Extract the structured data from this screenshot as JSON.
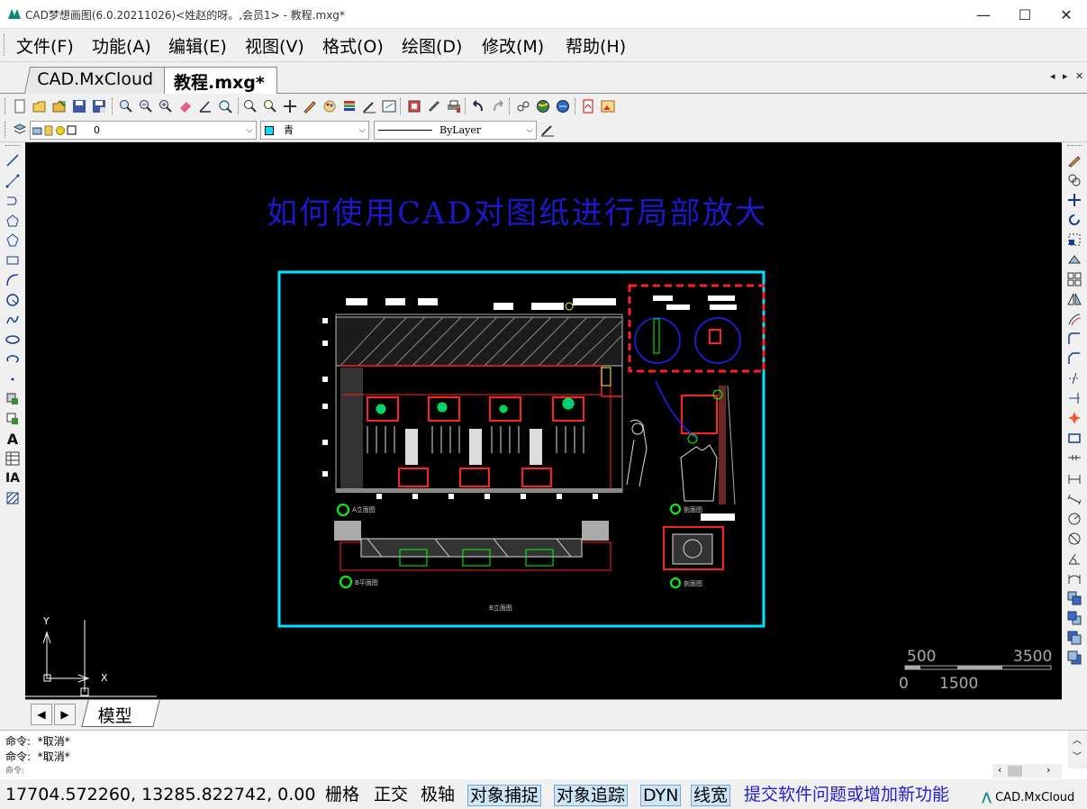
{
  "window": {
    "title": "CAD梦想画图(6.0.20211026)<姓赵的呀。,会员1> - 教程.mxg*",
    "minimize": "—",
    "maximize": "☐",
    "close": "✕"
  },
  "menu": [
    "文件(F)",
    "功能(A)",
    "编辑(E)",
    "视图(V)",
    "格式(O)",
    "绘图(D)",
    "修改(M)",
    "帮助(H)"
  ],
  "tabs": {
    "inactive": "CAD.MxCloud",
    "active": "教程.mxg*",
    "nav_left": "◂",
    "nav_right": "▸",
    "close": "✕"
  },
  "layer_bar": {
    "layer_value": "0",
    "color_value": "青",
    "linetype_value": "ByLayer"
  },
  "drawing": {
    "heading": "如何使用CAD对图纸进行局部放大",
    "label_elevation_a": "A立面图",
    "label_plan_b": "B平面图",
    "label_detail_c": "剖面图",
    "label_detail_d": "剖面图",
    "label_center": "B立面图",
    "scale_500": "500",
    "scale_3500": "3500",
    "scale_0": "0",
    "scale_1500": "1500",
    "ucs_x": "X",
    "ucs_y": "Y",
    "colors": {
      "frame": "#00e5ff",
      "heading": "#1a1acc",
      "highlight": "#ff0000"
    }
  },
  "model_tab": "模型",
  "command": {
    "line1_prefix": "命令:",
    "line1_text": "*取消*",
    "line2_prefix": "命令:",
    "line2_text": "*取消*",
    "line3_prefix": "命令:"
  },
  "status": {
    "coordinates": "17704.572260,  13285.822742,  0.00",
    "grid": "栅格",
    "ortho": "正交",
    "polar": "极轴",
    "osnap": "对象捕捉",
    "otrack": "对象追踪",
    "dyn": "DYN",
    "lineweight": "线宽",
    "feedback": "提交软件问题或增加新功能",
    "brand": "CAD.MxCloud"
  }
}
